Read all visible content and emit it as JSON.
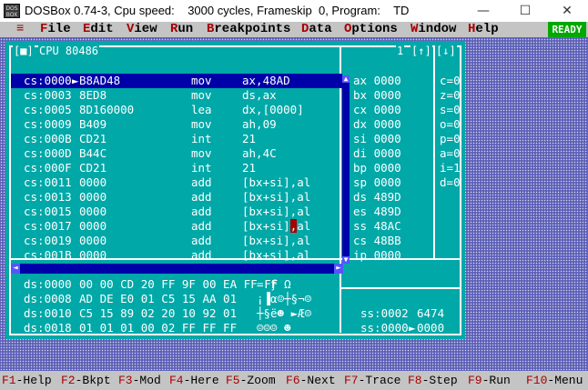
{
  "window": {
    "title": "DOSBox 0.74-3, Cpu speed:    3000 cycles, Frameskip  0, Program:    TD",
    "icon_text": "DOS BOX",
    "minimize": "—",
    "maximize": "☐",
    "close": "✕"
  },
  "menu": {
    "system": "≡",
    "items": [
      {
        "hot": "F",
        "rest": "ile"
      },
      {
        "hot": "E",
        "rest": "dit"
      },
      {
        "hot": "V",
        "rest": "iew"
      },
      {
        "hot": "R",
        "rest": "un"
      },
      {
        "hot": "B",
        "rest": "reakpoints"
      },
      {
        "hot": "D",
        "rest": "ata"
      },
      {
        "hot": "O",
        "rest": "ptions"
      },
      {
        "hot": "W",
        "rest": "indow"
      },
      {
        "hot": "H",
        "rest": "elp"
      }
    ],
    "status": "READY"
  },
  "cpu_window": {
    "close_box": "[■]",
    "title": "CPU 80486",
    "window_number": "1",
    "zoom_up": "[↑]",
    "zoom_down": "[↓]",
    "code_rows": [
      {
        "addr": "cs:0000",
        "marker": "►",
        "bytes": "B8AD48",
        "mnem": "mov",
        "ops": "ax,48AD"
      },
      {
        "addr": "cs:0003",
        "marker": " ",
        "bytes": "8ED8",
        "mnem": "mov",
        "ops": "ds,ax"
      },
      {
        "addr": "cs:0005",
        "marker": " ",
        "bytes": "8D160000",
        "mnem": "lea",
        "ops": "dx,[0000]"
      },
      {
        "addr": "cs:0009",
        "marker": " ",
        "bytes": "B409",
        "mnem": "mov",
        "ops": "ah,09"
      },
      {
        "addr": "cs:000B",
        "marker": " ",
        "bytes": "CD21",
        "mnem": "int",
        "ops": "21"
      },
      {
        "addr": "cs:000D",
        "marker": " ",
        "bytes": "B44C",
        "mnem": "mov",
        "ops": "ah,4C"
      },
      {
        "addr": "cs:000F",
        "marker": " ",
        "bytes": "CD21",
        "mnem": "int",
        "ops": "21"
      },
      {
        "addr": "cs:0011",
        "marker": " ",
        "bytes": "0000",
        "mnem": "add",
        "ops": "[bx+si],al"
      },
      {
        "addr": "cs:0013",
        "marker": " ",
        "bytes": "0000",
        "mnem": "add",
        "ops": "[bx+si],al"
      },
      {
        "addr": "cs:0015",
        "marker": " ",
        "bytes": "0000",
        "mnem": "add",
        "ops": "[bx+si],al"
      },
      {
        "addr": "cs:0017",
        "marker": " ",
        "bytes": "0000",
        "mnem": "add",
        "ops_pre": "[bx+si]",
        "ops_cursor": ",",
        "ops_post": "al"
      },
      {
        "addr": "cs:0019",
        "marker": " ",
        "bytes": "0000",
        "mnem": "add",
        "ops": "[bx+si],al"
      },
      {
        "addr": "cs:001B",
        "marker": " ",
        "bytes": "0000",
        "mnem": "add",
        "ops": "[bx+si],al"
      }
    ],
    "registers": [
      {
        "name": "ax",
        "value": "0000"
      },
      {
        "name": "bx",
        "value": "0000"
      },
      {
        "name": "cx",
        "value": "0000"
      },
      {
        "name": "dx",
        "value": "0000"
      },
      {
        "name": "si",
        "value": "0000"
      },
      {
        "name": "di",
        "value": "0000"
      },
      {
        "name": "bp",
        "value": "0000"
      },
      {
        "name": "sp",
        "value": "0000"
      },
      {
        "name": "ds",
        "value": "489D"
      },
      {
        "name": "es",
        "value": "489D"
      },
      {
        "name": "ss",
        "value": "48AC"
      },
      {
        "name": "cs",
        "value": "48BB"
      },
      {
        "name": "ip",
        "value": "0000"
      }
    ],
    "flags": [
      {
        "name": "c",
        "value": "0"
      },
      {
        "name": "z",
        "value": "0"
      },
      {
        "name": "s",
        "value": "0"
      },
      {
        "name": "o",
        "value": "0"
      },
      {
        "name": "p",
        "value": "0"
      },
      {
        "name": "a",
        "value": "0"
      },
      {
        "name": "i",
        "value": "1"
      },
      {
        "name": "d",
        "value": "0"
      }
    ],
    "dump_rows": [
      {
        "addr": "ds:0000",
        "bytes": "00 00 CD 20 FF 9F 00 EA FF FF",
        "ascii": "= ƒ Ω"
      },
      {
        "addr": "ds:0008",
        "bytes": "AD DE E0 01 C5 15 AA 01",
        "ascii": "¡▐α☺┼§¬☺"
      },
      {
        "addr": "ds:0010",
        "bytes": "C5 15 89 02 20 10 92 01",
        "ascii": "┼§ë☻ ►Æ☺"
      },
      {
        "addr": "ds:0018",
        "bytes": "01 01 01 00 02 FF FF FF",
        "ascii": "☺☺☺ ☻"
      }
    ],
    "stack_rows": [
      {
        "addr": "ss:0002",
        "marker": " ",
        "value": "6474"
      },
      {
        "addr": "ss:0000",
        "marker": "►",
        "value": "0000"
      }
    ]
  },
  "function_keys": [
    {
      "key": "F1",
      "label": "-Help"
    },
    {
      "key": "F2",
      "label": "-Bkpt"
    },
    {
      "key": "F3",
      "label": "-Mod"
    },
    {
      "key": "F4",
      "label": "-Here"
    },
    {
      "key": "F5",
      "label": "-Zoom"
    },
    {
      "key": "F6",
      "label": "-Next"
    },
    {
      "key": "F7",
      "label": "-Trace"
    },
    {
      "key": "F8",
      "label": "-Step"
    },
    {
      "key": "F9",
      "label": "-Run"
    },
    {
      "key": "F10",
      "label": "-Menu"
    }
  ],
  "colors": {
    "desktop": "#5b5fb6",
    "window_bg": "#00a8a8",
    "selection": "#0000a8",
    "hotkey": "#a80000",
    "ready": "#00a800"
  }
}
